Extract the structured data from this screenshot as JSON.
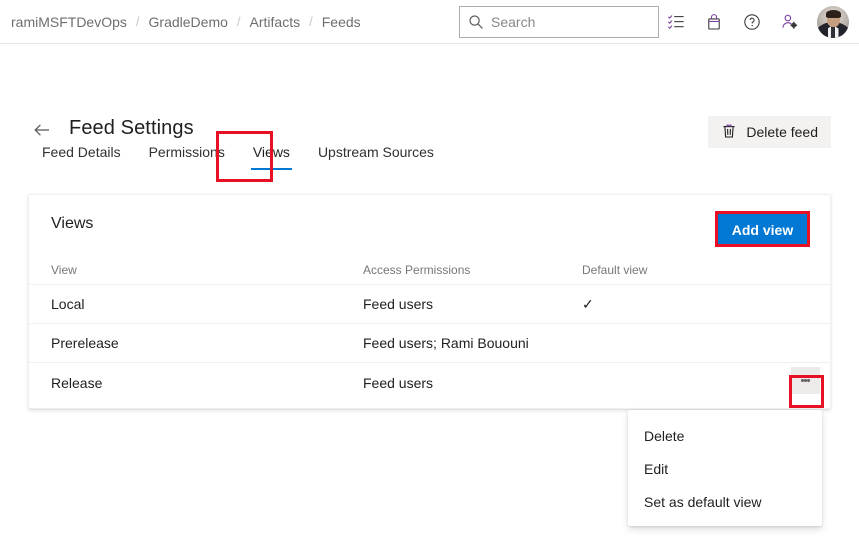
{
  "topbar": {
    "breadcrumb": [
      {
        "label": "ramiMSFTDevOps"
      },
      {
        "label": "GradleDemo"
      },
      {
        "label": "Artifacts"
      },
      {
        "label": "Feeds"
      }
    ],
    "separator": "/",
    "search": {
      "placeholder": "Search",
      "value": "",
      "icon": "search-icon"
    },
    "icons": [
      {
        "name": "tasks-checklist-icon"
      },
      {
        "name": "marketplace-bag-icon"
      },
      {
        "name": "help-question-icon"
      },
      {
        "name": "user-settings-icon"
      }
    ],
    "avatar": {
      "name": "user-avatar"
    }
  },
  "page": {
    "back_label": "back-arrow-icon",
    "title": "Feed Settings",
    "delete_feed": {
      "label": "Delete feed",
      "icon": "trash-icon"
    }
  },
  "tabs": [
    {
      "label": "Feed Details",
      "active": false
    },
    {
      "label": "Permissions",
      "active": false
    },
    {
      "label": "Views",
      "active": true
    },
    {
      "label": "Upstream Sources",
      "active": false
    }
  ],
  "card": {
    "title": "Views",
    "add_view_label": "Add view",
    "table": {
      "columns": [
        "View",
        "Access Permissions",
        "Default view"
      ],
      "rows": [
        {
          "view": "Local",
          "permissions": "Feed users",
          "default": true,
          "default_mark": "✓",
          "has_menu": false
        },
        {
          "view": "Prerelease",
          "permissions": "Feed users; Rami Bououni",
          "default": false,
          "default_mark": "",
          "has_menu": false
        },
        {
          "view": "Release",
          "permissions": "Feed users",
          "default": false,
          "default_mark": "",
          "has_menu": true
        }
      ]
    }
  },
  "context_menu": {
    "items": [
      {
        "label": "Delete"
      },
      {
        "label": "Edit"
      },
      {
        "label": "Set as default view"
      }
    ]
  },
  "annotations": {
    "color": "#e81123",
    "targets": [
      "views-tab",
      "add-view-button",
      "row-more-button"
    ]
  },
  "colors": {
    "accent": "#0078d4",
    "annotation": "#e81123",
    "text_primary": "#201f1e",
    "text_secondary": "#797775",
    "surface": "#ffffff",
    "button_neutral": "#f3f2f1"
  }
}
